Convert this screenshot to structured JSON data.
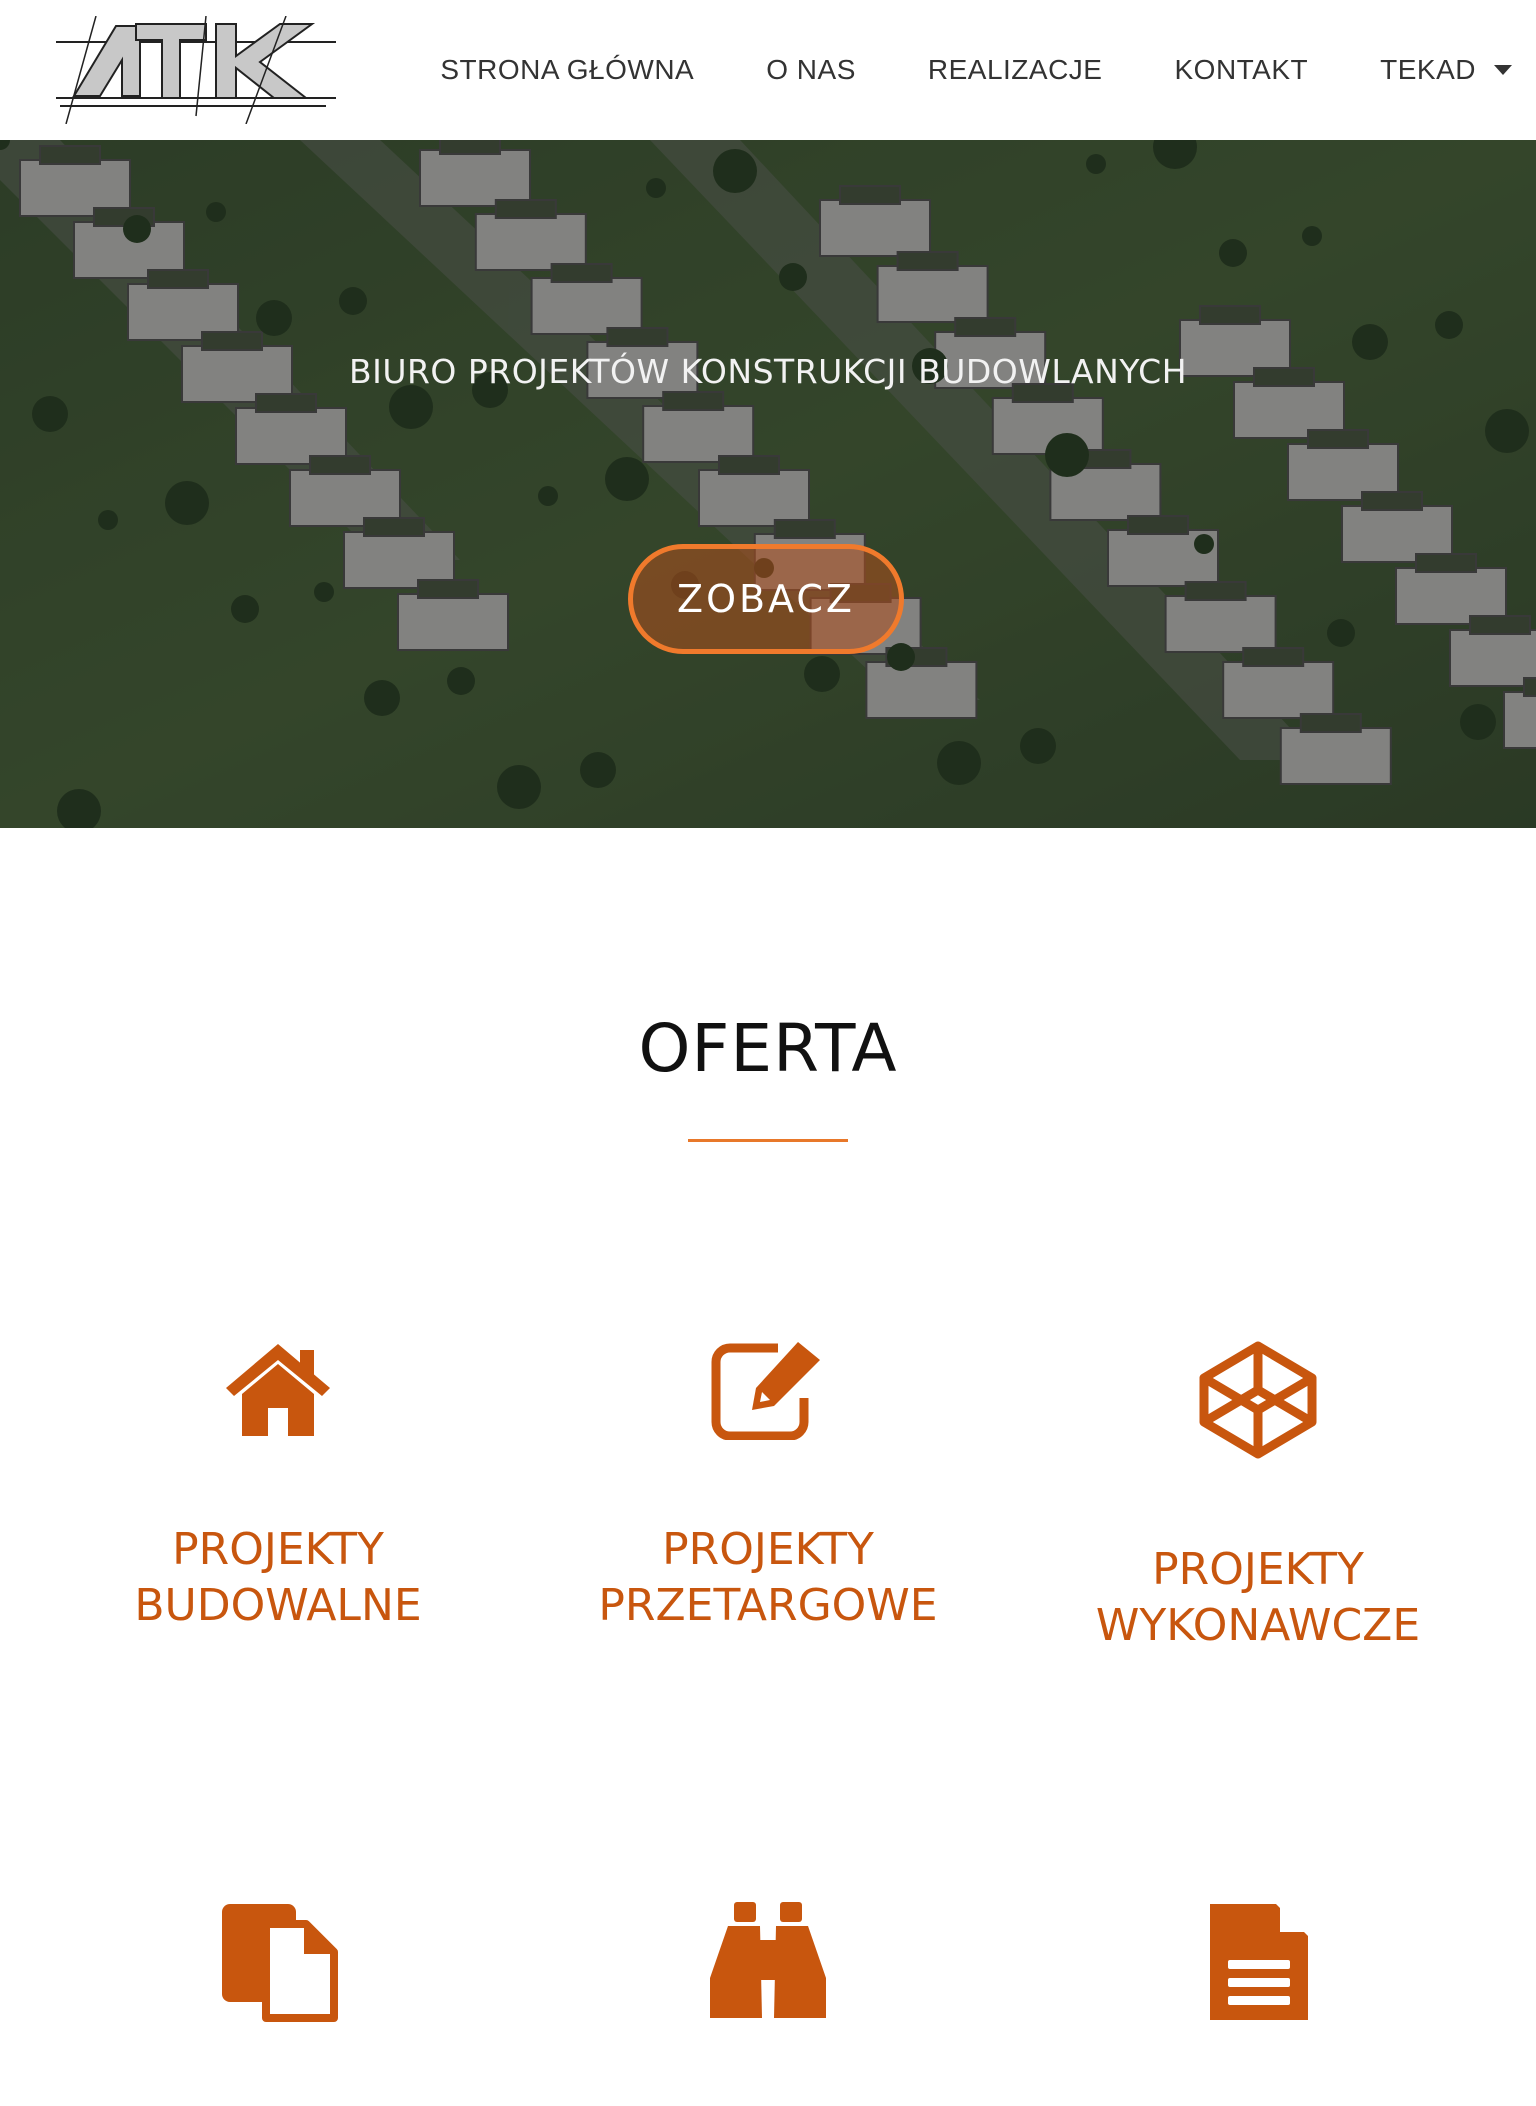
{
  "header": {
    "logo_text": "ATK",
    "nav": [
      {
        "label": "STRONA GŁÓWNA"
      },
      {
        "label": "O NAS"
      },
      {
        "label": "REALIZACJE"
      },
      {
        "label": "KONTAKT"
      },
      {
        "label": "TEKAD",
        "icon": "caret-down-icon"
      }
    ]
  },
  "hero": {
    "subtitle": "BIURO PROJEKTÓW KONSTRUKCJI BUDOWLANYCH",
    "button_label": "ZOBACZ"
  },
  "offer": {
    "title": "OFERTA",
    "accent_color": "#e8782a",
    "items": [
      {
        "label": "PROJEKTY\nBUDOWALNE",
        "icon": "house-icon"
      },
      {
        "label": "PROJEKTY\nPRZETARGOWE",
        "icon": "edit-icon"
      },
      {
        "label": "PROJEKTY\nWYKONAWCZE",
        "icon": "cube-icon"
      },
      {
        "label": "",
        "icon": "copy-files-icon"
      },
      {
        "label": "",
        "icon": "binoculars-icon"
      },
      {
        "label": "",
        "icon": "document-icon"
      }
    ]
  }
}
